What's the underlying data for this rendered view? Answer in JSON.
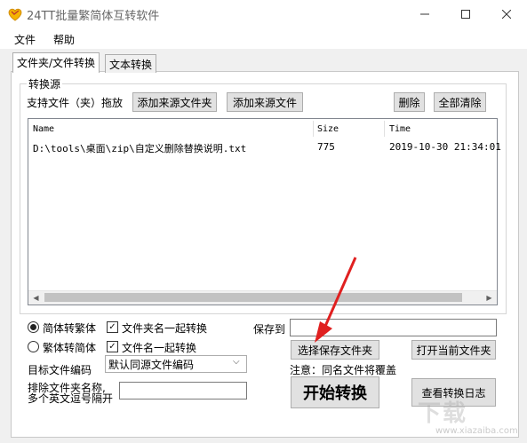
{
  "window": {
    "title": "24TT批量繁简体互转软件",
    "controls": {
      "minimize": "—",
      "maximize": "☐",
      "close": "✕"
    }
  },
  "menu": {
    "file": "文件",
    "help": "帮助"
  },
  "tabs": {
    "folder_file": "文件夹/文件转换",
    "text": "文本转换"
  },
  "source": {
    "group_title": "转换源",
    "hint": "支持文件（夹）拖放",
    "add_folder": "添加来源文件夹",
    "add_file": "添加来源文件",
    "delete": "删除",
    "clear_all": "全部清除"
  },
  "table": {
    "columns": [
      "Name",
      "Size",
      "Time"
    ],
    "rows": [
      {
        "name": "D:\\tools\\桌面\\zip\\自定义删除替换说明.txt",
        "size": "775",
        "time": "2019-10-30 21:34:01"
      }
    ]
  },
  "options": {
    "radio_s2t": "简体转繁体",
    "radio_t2s": "繁体转简体",
    "radio_selected": "s2t",
    "check_folder_name": "文件夹名一起转换",
    "check_file_name": "文件名一起转换",
    "check_mark": "✓",
    "encoding_label": "目标文件编码",
    "encoding_value": "默认同源文件编码",
    "exclude_label_1": "排除文件夹名称,",
    "exclude_label_2": "多个英文逗号隔开"
  },
  "save": {
    "label": "保存到",
    "choose_folder": "选择保存文件夹",
    "open_folder": "打开当前文件夹",
    "note": "注意：同名文件将覆盖",
    "start": "开始转换",
    "view_log": "查看转换日志"
  },
  "watermark": {
    "main": "下载",
    "sub": "www.xiazaiba.com"
  },
  "colors": {
    "arrow": "#e02020",
    "app_icon": "#f5b400"
  }
}
